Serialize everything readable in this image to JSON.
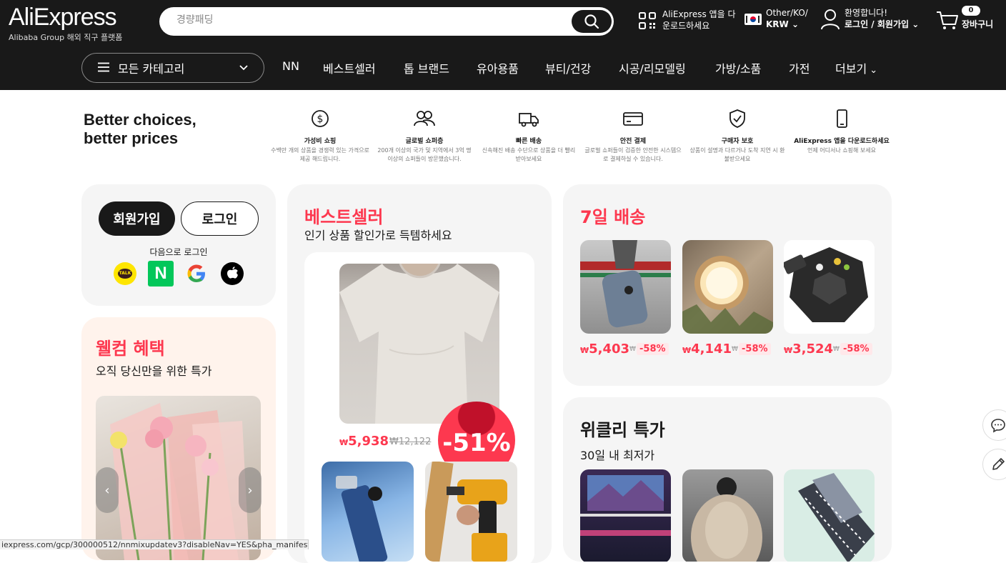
{
  "header": {
    "logo": "AliExpress",
    "logo_sub": "Alibaba Group 해외 직구 플랫폼",
    "search_placeholder": "경량패딩",
    "app_line1": "AliExpress 앱을 다",
    "app_line2": "운로드하세요",
    "region_line1": "Other/KO/",
    "region_line2": "KRW",
    "account_line1": "환영합니다!",
    "account_line2": "로그인 / 회원가입",
    "cart_count": "0",
    "cart_label": "장바구니"
  },
  "nav": {
    "all_categories": "모든 카테고리",
    "links": [
      "NN",
      "베스트셀러",
      "톱 브랜드",
      "유아용품",
      "뷰티/건강",
      "시공/리모델링",
      "가방/소품",
      "가전",
      "더보기"
    ]
  },
  "banner": {
    "title_line1": "Better choices,",
    "title_line2": "better prices",
    "features": [
      {
        "title": "가성비 쇼핑",
        "desc": "수백만 개의 상품을 경쟁력 있는 가격으로 제공 해드립니다."
      },
      {
        "title": "글로벌 쇼퍼층",
        "desc": "200개 이상의 국가 및 지역에서 3억 명 이상의 쇼퍼들이 방문했습니다."
      },
      {
        "title": "빠른 배송",
        "desc": "신속해진 배송 수단으로 상품을 더 빨리 받아보세요"
      },
      {
        "title": "안전 결제",
        "desc": "글로벌 쇼퍼들이 검증한 안전한 시스템으로 결제하실 수 있습니다."
      },
      {
        "title": "구매자 보호",
        "desc": "상품이 설명과 다르거나 도착 지연 시 환불받으세요"
      },
      {
        "title": "AliExpress 앱을 다운로드하세요",
        "desc": "언제 어디서나 쇼핑해 보세요"
      }
    ]
  },
  "login_card": {
    "signup": "회원가입",
    "login": "로그인",
    "login_with": "다음으로 로그인"
  },
  "welcome": {
    "title": "웰컴 혜택",
    "subtitle": "오직 당신만을 위한 특가"
  },
  "bestseller": {
    "title": "베스트셀러",
    "subtitle": "인기 상품 할인가로 득템하세요",
    "price_symbol": "₩",
    "price": "5,938",
    "original": "₩12,122",
    "discount": "-51%"
  },
  "seven_day": {
    "title": "7일 배송",
    "items": [
      {
        "price": "5,403",
        "disc": "-58%"
      },
      {
        "price": "4,141",
        "disc": "-58%"
      },
      {
        "price": "3,524",
        "disc": "-58%"
      }
    ],
    "price_symbol": "₩"
  },
  "weekly": {
    "title": "위클리 특가",
    "subtitle": "30일 내 최저가"
  },
  "status_url": "iexpress.com/gcp/300000512/nnmixupdatev3?disableNav=YES&pha_manifest",
  "colors": {
    "accent": "#fd384f",
    "dark": "#191919"
  }
}
